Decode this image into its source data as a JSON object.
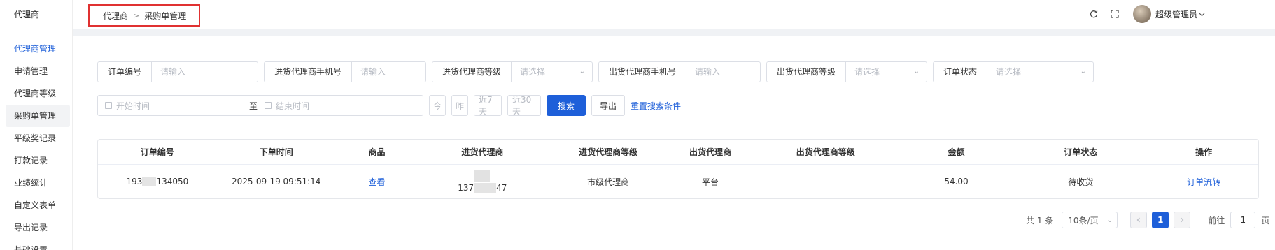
{
  "sidebar": {
    "brand": "代理商",
    "items": [
      {
        "label": "代理商管理"
      },
      {
        "label": "申请管理"
      },
      {
        "label": "代理商等级"
      },
      {
        "label": "采购单管理"
      },
      {
        "label": "平级奖记录"
      },
      {
        "label": "打款记录"
      },
      {
        "label": "业绩统计"
      },
      {
        "label": "自定义表单"
      },
      {
        "label": "导出记录"
      },
      {
        "label": "基础设置"
      }
    ]
  },
  "breadcrumb": {
    "root": "代理商",
    "current": "采购单管理"
  },
  "header": {
    "user_name": "超级管理员",
    "icons": [
      "refresh-icon",
      "fullscreen-icon",
      "chevron-down-icon"
    ]
  },
  "filters": {
    "order_no": {
      "label": "订单编号",
      "placeholder": "请输入"
    },
    "buyer_phone": {
      "label": "进货代理商手机号",
      "placeholder": "请输入"
    },
    "buyer_level": {
      "label": "进货代理商等级",
      "placeholder": "请选择"
    },
    "seller_phone": {
      "label": "出货代理商手机号",
      "placeholder": "请输入"
    },
    "seller_level": {
      "label": "出货代理商等级",
      "placeholder": "请选择"
    },
    "status": {
      "label": "订单状态",
      "placeholder": "请选择"
    },
    "date": {
      "start_placeholder": "开始时间",
      "separator": "至",
      "end_placeholder": "结束时间"
    },
    "quick": {
      "today": "今",
      "yesterday": "昨",
      "last7": "近7天",
      "last30": "近30天"
    },
    "search": "搜索",
    "export": "导出",
    "reset": "重置搜索条件"
  },
  "table": {
    "headers": [
      "订单编号",
      "下单时间",
      "商品",
      "进货代理商",
      "进货代理商等级",
      "出货代理商",
      "出货代理商等级",
      "金额",
      "订单状态",
      "操作"
    ],
    "rows": [
      {
        "order_no_prefix": "193",
        "order_no_suffix": "134050",
        "time": "2025-09-19 09:51:14",
        "goods": "查看",
        "buyer_phone_prefix": "137",
        "buyer_phone_suffix": "47",
        "buyer_level": "市级代理商",
        "seller": "平台",
        "seller_level": "",
        "amount": "54.00",
        "status": "待收货",
        "action": "订单流转"
      }
    ]
  },
  "pagination": {
    "total": "共 1 条",
    "page_size": "10条/页",
    "current_page": "1",
    "goto_label": "前往",
    "goto_value": "1",
    "page_unit": "页"
  }
}
